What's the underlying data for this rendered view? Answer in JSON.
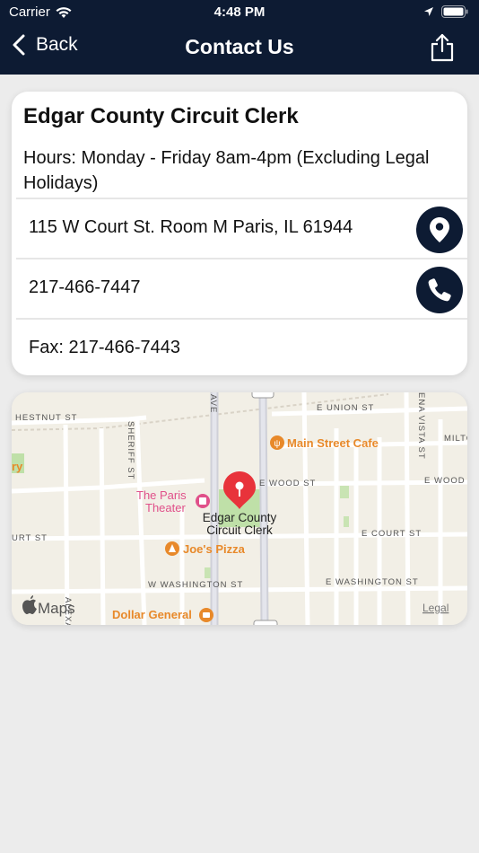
{
  "status_bar": {
    "carrier": "Carrier",
    "time": "4:48 PM"
  },
  "nav": {
    "back_label": "Back",
    "title": "Contact Us"
  },
  "contact": {
    "name": "Edgar County Circuit Clerk",
    "hours": "Hours: Monday - Friday 8am-4pm (Excluding Legal Holidays)",
    "address": "115 W Court St. Room M Paris, IL 61944",
    "phone": "217-466-7447",
    "fax": "Fax: 217-466-7443"
  },
  "map": {
    "streets": {
      "chestnut": "HESTNUT ST",
      "union": "E UNION ST",
      "sheriff": "SHERIFF ST",
      "ave": "AVE",
      "vista": "ENA VISTA ST",
      "milton": "MILTO",
      "wood1": "E WOOD ST",
      "wood2": "E WOOD S",
      "court_w": "URT ST",
      "court_e": "E COURT ST",
      "washington_w": "W WASHINGTON ST",
      "washington_e": "E WASHINGTON ST",
      "alexander": "ALEXANDE"
    },
    "pois": {
      "cafe": "Main Street Cafe",
      "theater_line1": "The Paris",
      "theater_line2": "Theater",
      "pin_line1": "Edgar County",
      "pin_line2": "Circuit Clerk",
      "pizza": "Joe's Pizza",
      "dollar": "Dollar General",
      "partial_left": "ry"
    },
    "attribution": "Maps",
    "legal": "Legal",
    "colors": {
      "pin": "#e8333b",
      "poi_orange": "#e8892a",
      "poi_pink": "#e0508a",
      "park": "#bfe0a8"
    }
  }
}
